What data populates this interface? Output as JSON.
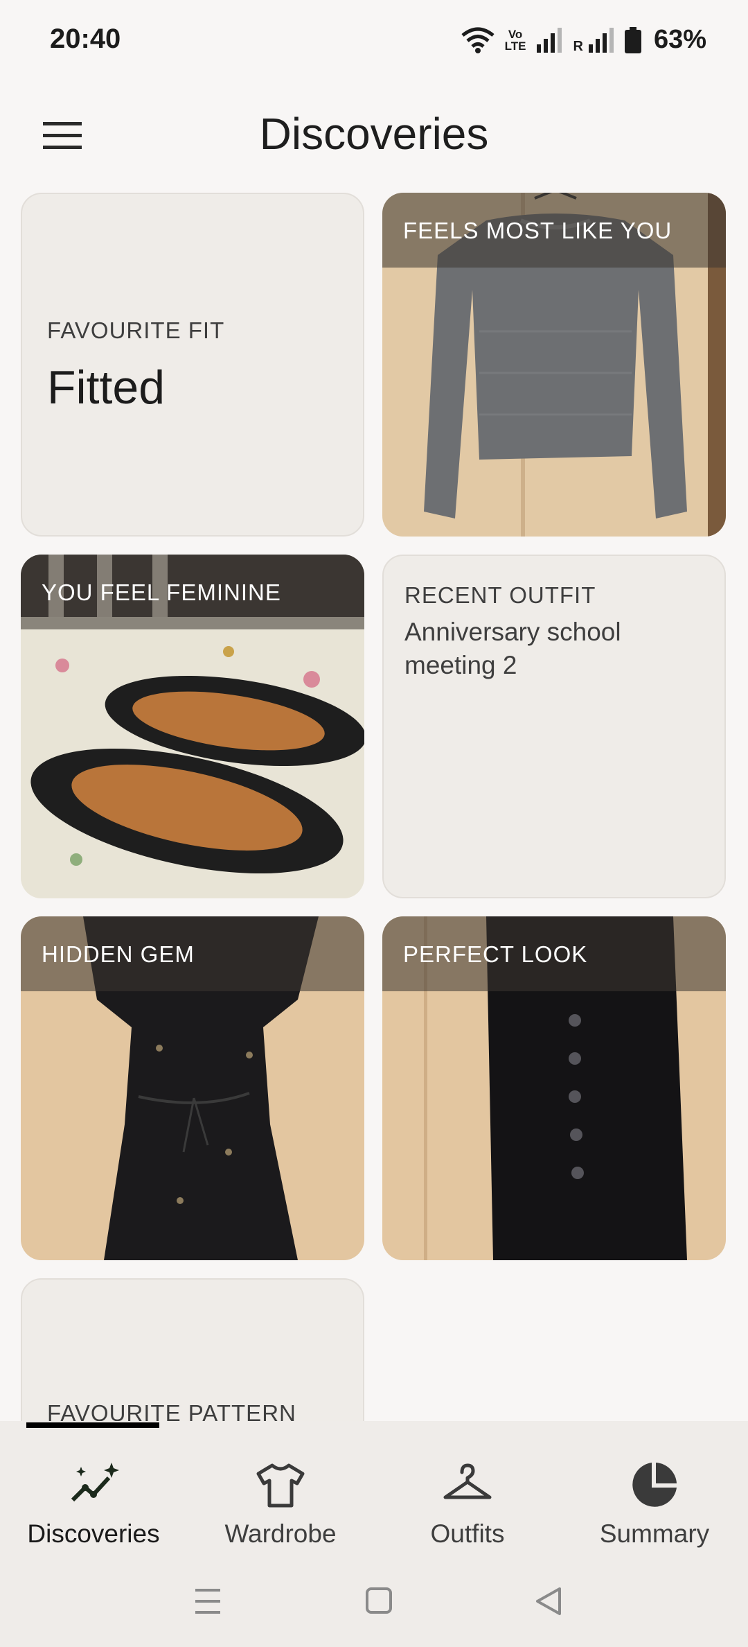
{
  "status": {
    "time": "20:40",
    "battery_pct": "63%",
    "volte_top": "Vo",
    "volte_bottom": "LTE",
    "roaming_mark": "R",
    "icons": [
      "wifi-icon",
      "volte-icon",
      "signal-icon",
      "roaming-signal-icon",
      "battery-icon"
    ]
  },
  "app_bar": {
    "title": "Discoveries",
    "menu_icon": "hamburger-menu-icon"
  },
  "cards": {
    "favourite_fit": {
      "label": "FAVOURITE FIT",
      "value": "Fitted"
    },
    "feels_most_like_you": {
      "label": "FEELS MOST LIKE YOU",
      "image": "grey-knit-sweater"
    },
    "you_feel_feminine": {
      "label": "YOU FEEL FEMININE",
      "image": "black-mary-jane-shoes"
    },
    "recent_outfit": {
      "label": "RECENT OUTFIT",
      "value": "Anniversary school meeting 2"
    },
    "hidden_gem": {
      "label": "HIDDEN GEM",
      "image": "black-embroidered-dress"
    },
    "perfect_look": {
      "label": "PERFECT LOOK",
      "image": "black-button-skirt"
    },
    "favourite_pattern": {
      "label": "FAVOURITE PATTERN"
    }
  },
  "bottom_nav": {
    "items": [
      {
        "label": "Discoveries",
        "icon": "sparkle-trend-icon",
        "active": true
      },
      {
        "label": "Wardrobe",
        "icon": "tshirt-icon",
        "active": false
      },
      {
        "label": "Outfits",
        "icon": "hanger-icon",
        "active": false
      },
      {
        "label": "Summary",
        "icon": "pie-chart-icon",
        "active": false
      }
    ]
  },
  "system_nav": {
    "icons": [
      "recents-icon",
      "home-icon",
      "back-icon"
    ]
  },
  "colors": {
    "background": "#f8f6f5",
    "card_background": "#efece8",
    "nav_background": "#efece9",
    "text_primary": "#1c1c1c",
    "text_secondary": "#3e3e3e"
  }
}
